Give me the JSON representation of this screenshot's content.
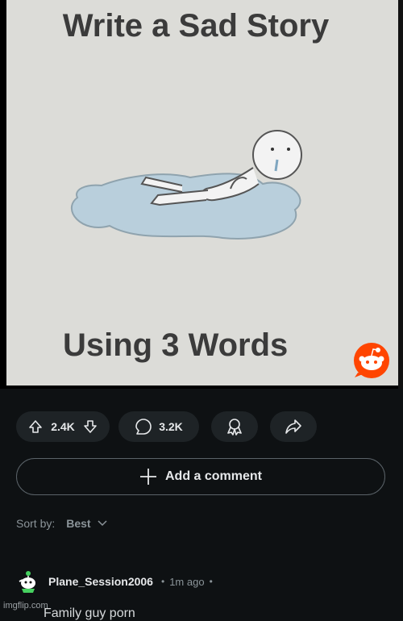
{
  "post": {
    "meme_title": "Write a Sad Story",
    "meme_caption": "Using 3 Words"
  },
  "actions": {
    "upvotes": "2.4K",
    "comments": "3.2K",
    "upvote_icon": "arrow-up-outline",
    "downvote_icon": "arrow-down-outline",
    "comment_icon": "speech-bubble",
    "award_icon": "award-ribbon",
    "share_icon": "share-arrow"
  },
  "add_comment": {
    "label": "Add a comment"
  },
  "sort": {
    "label": "Sort by:",
    "value": "Best"
  },
  "comment": {
    "username": "Plane_Session2006",
    "time": "1m ago",
    "body": "Family guy porn"
  },
  "watermark": "imgflip.com",
  "colors": {
    "background": "#0e1113",
    "button": "#1e2326",
    "reddit_orange": "#ff4500"
  }
}
